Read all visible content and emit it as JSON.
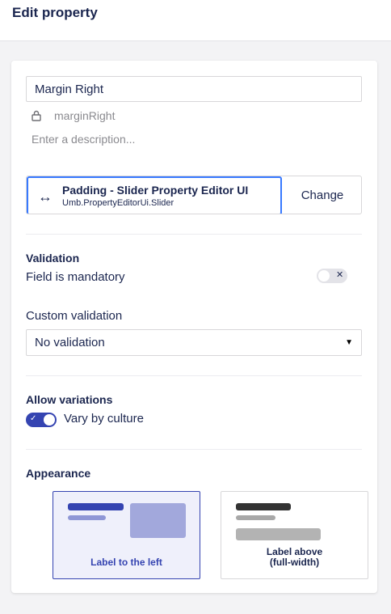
{
  "header": {
    "title": "Edit property"
  },
  "property": {
    "name": "Margin Right",
    "alias": "marginRight",
    "description_placeholder": "Enter a description..."
  },
  "editor": {
    "name": "Padding - Slider Property Editor UI",
    "alias": "Umb.PropertyEditorUi.Slider",
    "change_label": "Change",
    "icon": "arrow-left-right-icon"
  },
  "validation": {
    "heading": "Validation",
    "mandatory_label": "Field is mandatory",
    "mandatory_on": false,
    "custom_label": "Custom validation",
    "custom_selected": "No validation"
  },
  "variations": {
    "heading": "Allow variations",
    "vary_by_culture_label": "Vary by culture",
    "vary_by_culture_on": true
  },
  "appearance": {
    "heading": "Appearance",
    "options": [
      {
        "label": "Label to the left",
        "selected": true
      },
      {
        "label": "Label above\n(full-width)",
        "selected": false
      }
    ]
  },
  "colors": {
    "accent": "#3544b1",
    "focus": "#3879ff",
    "text": "#1b264f",
    "muted": "#8a8a8f"
  }
}
